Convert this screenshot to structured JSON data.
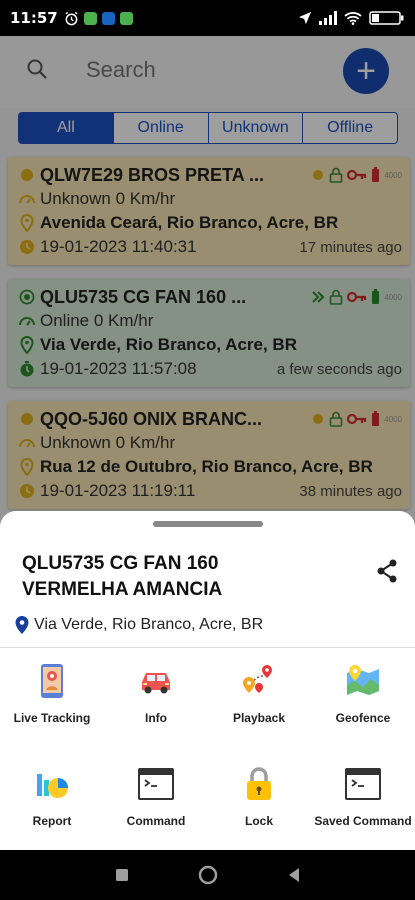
{
  "status_bar": {
    "time": "11:57"
  },
  "search": {
    "placeholder": "Search"
  },
  "fab": {
    "label": "+"
  },
  "filters": [
    "All",
    "Online",
    "Unknown",
    "Offline"
  ],
  "vehicles": [
    {
      "title": "QLW7E29 BROS PRETA ...",
      "status": "Unknown 0 Km/hr",
      "address": "Avenida Ceará, Rio Branco, Acre, BR",
      "datetime": "19-01-2023 11:40:31",
      "ago": "17 minutes ago",
      "tag": "4000"
    },
    {
      "title": "QLU5735 CG FAN 160 ...",
      "status": "Online 0 Km/hr",
      "address": "Via Verde, Rio Branco, Acre, BR",
      "datetime": "19-01-2023 11:57:08",
      "ago": "a few seconds ago",
      "tag": "4000"
    },
    {
      "title": "QQO-5J60 ONIX  BRANC...",
      "status": "Unknown 0 Km/hr",
      "address": "Rua 12 de Outubro, Rio Branco, Acre, BR",
      "datetime": "19-01-2023 11:19:11",
      "ago": "38 minutes ago",
      "tag": "4000"
    }
  ],
  "sheet": {
    "title_line1": "QLU5735 CG FAN 160",
    "title_line2": "VERMELHA AMANCIA",
    "address": "Via Verde, Rio Branco, Acre, BR",
    "actions": [
      "Live Tracking",
      "Info",
      "Playback",
      "Geofence",
      "Report",
      "Command",
      "Lock",
      "Saved Command"
    ]
  },
  "colors": {
    "primary": "#1e52c2",
    "unknown_card": "#f7e6b3",
    "online_card": "#d7ead6",
    "online_green": "#2e8b2e",
    "key_red": "#d32f2f"
  }
}
